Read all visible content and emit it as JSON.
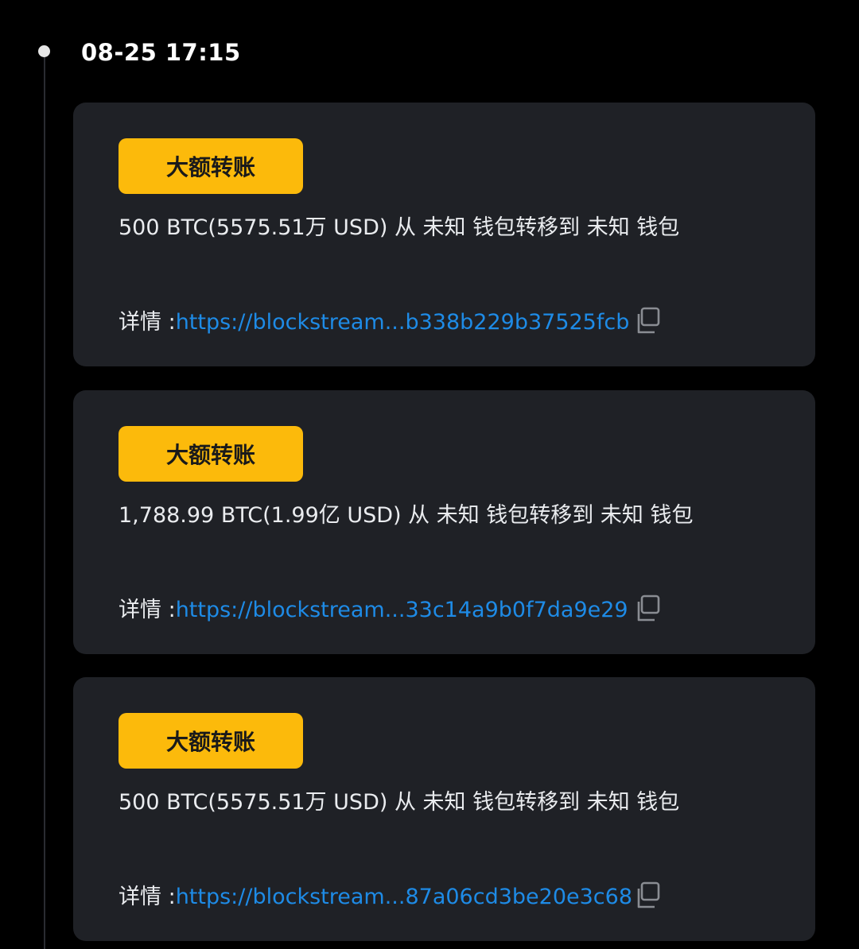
{
  "timeline": {
    "timestamp": "08-25 17:15"
  },
  "cards": [
    {
      "badge": "大额转账",
      "message": "500 BTC(5575.51万 USD) 从 未知 钱包转移到 未知 钱包",
      "detail_label": "详情 :",
      "link": "https://blockstream...b338b229b37525fcb"
    },
    {
      "badge": "大额转账",
      "message": "1,788.99 BTC(1.99亿 USD) 从 未知 钱包转移到 未知 钱包",
      "detail_label": "详情 :",
      "link": "https://blockstream...33c14a9b0f7da9e29"
    },
    {
      "badge": "大额转账",
      "message": "500 BTC(5575.51万 USD) 从 未知 钱包转移到 未知 钱包",
      "detail_label": "详情 :",
      "link": "https://blockstream...87a06cd3be20e3c68"
    }
  ],
  "icons": {
    "copy": "copy-icon",
    "timeline_dot": "timeline-dot"
  },
  "colors": {
    "background": "#000000",
    "card": "#1f2126",
    "badge": "#fcba0b",
    "link": "#1e8be6",
    "text": "#eaecef"
  }
}
